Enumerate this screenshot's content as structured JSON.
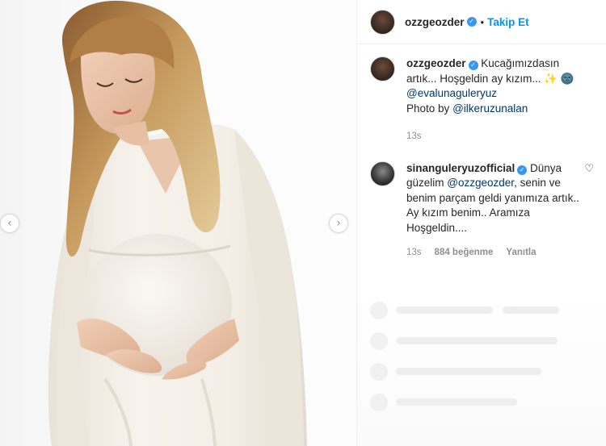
{
  "post": {
    "username": "ozzgeozder",
    "verified": true,
    "follow_label": "Takip Et",
    "separator": "•"
  },
  "nav": {
    "prev_icon": "‹",
    "next_icon": "›"
  },
  "caption": {
    "username": "ozzgeozder",
    "text_1": "Kucağımızdasın artık...",
    "text_2": "Hoşgeldin ay kızım...",
    "mention_1": "@evalunaguleryuz",
    "photo_by": "Photo by",
    "mention_2": "@ilkeruzunalan",
    "time": "13s"
  },
  "comment": {
    "username": "sinanguleryuzofficial",
    "verified": true,
    "text_1": "Dünya güzelim",
    "mention": "@ozzgeozder",
    "text_2": ", senin ve benim parçam geldi yanımıza artık.. Ay kızım benim.. Aramıza Hoşgeldin....",
    "time": "13s",
    "likes": "884 beğenme",
    "reply": "Yanıtla",
    "heart_icon": "♡"
  },
  "colors": {
    "accent": "#0095f6",
    "verified": "#3897f0",
    "link": "#00376b",
    "muted": "#8e8e8e"
  }
}
